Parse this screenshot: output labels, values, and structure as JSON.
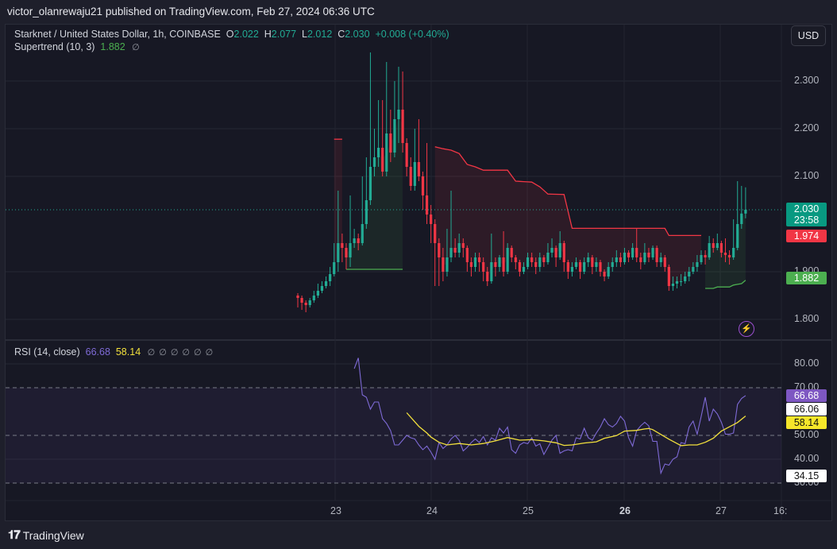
{
  "publisher": "victor_olanrewaju21 published on TradingView.com, Feb 27, 2024 06:36 UTC",
  "header": {
    "symbol": "Starknet / United States Dollar, 1h, COINBASE",
    "o_label": "O",
    "o": "2.022",
    "h_label": "H",
    "h": "2.077",
    "l_label": "L",
    "l": "2.012",
    "c_label": "C",
    "c": "2.030",
    "change": "+0.008 (+0.40%)",
    "supertrend_label": "Supertrend (10, 3)",
    "supertrend_value": "1.882",
    "rsi_label": "RSI (14, close)",
    "rsi_value": "66.68",
    "rsi_ma_value": "58.14",
    "empty_symbol": "∅"
  },
  "currency_button": "USD",
  "footer": {
    "logo": "TV",
    "brand": "TradingView"
  },
  "colors": {
    "up": "#22ab94",
    "down": "#f23645",
    "supertrend_up": "#4caf50",
    "supertrend_down": "#f23645",
    "rsi": "#7e6ad6",
    "rsi_ma": "#f2e03c",
    "background": "#171824"
  },
  "badges": {
    "last_price": "2.030",
    "countdown": "23:58",
    "supertrend_down": "1.974",
    "supertrend_up": "1.882",
    "rsi": "66.68",
    "rsi_a": "66.06",
    "rsi_ma": "58.14",
    "rsi_b": "34.15"
  },
  "chart_data": [
    {
      "type": "candlestick",
      "interval": "1h",
      "price_ticks": [
        "2.300",
        "2.200",
        "2.100",
        "1.900",
        "1.800"
      ],
      "ylim": [
        1.8,
        2.3
      ],
      "x_ticks": [
        "23",
        "24",
        "25",
        "26",
        "27",
        "16:"
      ],
      "grid": true,
      "close": [
        1.845,
        1.835,
        1.83,
        1.84,
        1.85,
        1.86,
        1.87,
        1.88,
        1.895,
        1.92,
        1.96,
        1.95,
        1.93,
        1.96,
        1.97,
        1.96,
        2.0,
        2.05,
        2.12,
        2.14,
        2.16,
        2.11,
        2.19,
        2.15,
        2.22,
        2.24,
        2.17,
        2.12,
        2.08,
        2.13,
        2.1,
        2.06,
        2.02,
        2.0,
        1.96,
        1.93,
        1.9,
        1.93,
        1.95,
        1.94,
        1.96,
        1.95,
        1.92,
        1.91,
        1.93,
        1.92,
        1.9,
        1.88,
        1.92,
        1.91,
        1.93,
        1.9,
        1.95,
        1.93,
        1.92,
        1.9,
        1.91,
        1.93,
        1.92,
        1.91,
        1.93,
        1.92,
        1.94,
        1.95,
        1.93,
        1.96,
        1.92,
        1.9,
        1.91,
        1.92,
        1.9,
        1.92,
        1.93,
        1.91,
        1.92,
        1.9,
        1.89,
        1.91,
        1.92,
        1.93,
        1.92,
        1.94,
        1.93,
        1.95,
        1.93,
        1.92,
        1.94,
        1.93,
        1.95,
        1.92,
        1.93,
        1.91,
        1.87,
        1.875,
        1.88,
        1.88,
        1.89,
        1.9,
        1.91,
        1.92,
        1.935,
        1.93,
        1.96,
        1.95,
        1.96,
        1.94,
        1.935,
        1.93,
        1.95,
        2.0,
        2.022,
        2.03
      ],
      "high": [
        1.855,
        1.85,
        1.84,
        1.845,
        1.86,
        1.875,
        1.88,
        1.89,
        1.91,
        1.96,
        2.07,
        1.98,
        1.96,
        2.06,
        1.99,
        1.98,
        2.1,
        2.14,
        2.36,
        2.2,
        2.26,
        2.26,
        2.34,
        2.24,
        2.3,
        2.33,
        2.32,
        2.18,
        2.14,
        2.2,
        2.22,
        2.11,
        2.17,
        2.04,
        2.01,
        1.97,
        1.95,
        1.99,
        2.07,
        1.97,
        1.98,
        1.97,
        1.955,
        1.93,
        1.94,
        1.94,
        1.93,
        1.91,
        1.98,
        1.93,
        1.935,
        1.985,
        1.96,
        1.955,
        1.935,
        1.925,
        1.92,
        1.94,
        1.94,
        1.93,
        1.94,
        1.935,
        1.96,
        1.97,
        1.955,
        1.985,
        1.965,
        1.925,
        1.92,
        1.93,
        1.925,
        1.93,
        1.94,
        1.935,
        1.93,
        1.925,
        1.905,
        1.92,
        1.93,
        1.945,
        1.94,
        1.95,
        1.945,
        1.96,
        1.99,
        1.94,
        1.96,
        1.95,
        1.955,
        1.955,
        1.94,
        1.935,
        1.915,
        1.89,
        1.89,
        1.895,
        1.9,
        1.91,
        1.92,
        1.935,
        1.945,
        1.945,
        1.975,
        1.97,
        1.98,
        1.965,
        1.97,
        1.945,
        2.01,
        2.09,
        2.08,
        2.077
      ],
      "low": [
        1.825,
        1.82,
        1.815,
        1.825,
        1.835,
        1.845,
        1.855,
        1.865,
        1.87,
        1.89,
        1.9,
        1.92,
        1.905,
        1.91,
        1.95,
        1.945,
        1.955,
        1.99,
        2.04,
        2.1,
        2.12,
        2.1,
        2.1,
        2.13,
        2.14,
        2.17,
        2.15,
        2.1,
        2.07,
        2.07,
        2.09,
        2.03,
        2.0,
        1.96,
        1.87,
        1.87,
        1.88,
        1.89,
        1.92,
        1.93,
        1.93,
        1.93,
        1.9,
        1.89,
        1.9,
        1.9,
        1.88,
        1.87,
        1.875,
        1.89,
        1.9,
        1.89,
        1.895,
        1.92,
        1.905,
        1.89,
        1.895,
        1.905,
        1.91,
        1.895,
        1.9,
        1.91,
        1.915,
        1.93,
        1.91,
        1.925,
        1.9,
        1.885,
        1.89,
        1.905,
        1.885,
        1.895,
        1.91,
        1.895,
        1.9,
        1.89,
        1.88,
        1.885,
        1.9,
        1.91,
        1.91,
        1.915,
        1.92,
        1.925,
        1.92,
        1.905,
        1.915,
        1.92,
        1.925,
        1.91,
        1.91,
        1.9,
        1.86,
        1.86,
        1.865,
        1.87,
        1.875,
        1.88,
        1.895,
        1.9,
        1.915,
        1.915,
        1.925,
        1.94,
        1.945,
        1.93,
        1.92,
        1.915,
        1.925,
        1.945,
        1.99,
        2.012
      ],
      "supertrend": [
        {
          "direction": "down",
          "points": [
            [
              9,
              2.178
            ],
            [
              11,
              2.178
            ]
          ]
        },
        {
          "direction": "up",
          "points": [
            [
              12,
              1.905
            ],
            [
              26,
              1.905
            ]
          ]
        },
        {
          "direction": "down",
          "points": [
            [
              34,
              2.162
            ],
            [
              36,
              2.158
            ],
            [
              38,
              2.155
            ],
            [
              40,
              2.148
            ],
            [
              42,
              2.125
            ],
            [
              44,
              2.12
            ],
            [
              46,
              2.113
            ],
            [
              52,
              2.113
            ],
            [
              54,
              2.09
            ],
            [
              58,
              2.088
            ],
            [
              60,
              2.078
            ],
            [
              62,
              2.063
            ],
            [
              66,
              2.062
            ],
            [
              68,
              1.991
            ],
            [
              91,
              1.991
            ],
            [
              92,
              1.976
            ],
            [
              100,
              1.976
            ]
          ]
        },
        {
          "direction": "up",
          "points": [
            [
              101,
              1.865
            ],
            [
              103,
              1.865
            ],
            [
              104,
              1.868
            ],
            [
              107,
              1.868
            ],
            [
              108,
              1.872
            ],
            [
              110,
              1.875
            ],
            [
              111,
              1.882
            ]
          ]
        }
      ]
    },
    {
      "type": "line",
      "name": "RSI (14, close)",
      "y_ticks": [
        "80.00",
        "70.00",
        "50.00",
        "40.00",
        "30.00"
      ],
      "ylim": [
        26,
        90
      ],
      "bands": [
        70,
        50,
        30
      ],
      "rsi_start_index": 14,
      "rsi": [
        78,
        82.5,
        67,
        66,
        61,
        64,
        64,
        57,
        55,
        52,
        46,
        46,
        48,
        50,
        49,
        48.5,
        46,
        44,
        45.5,
        43,
        40,
        47,
        44.5,
        46,
        48.5,
        50,
        48,
        43.5,
        45,
        47,
        48.5,
        47,
        49.5,
        46,
        49,
        48,
        53,
        51,
        53.5,
        44,
        42.5,
        46,
        47,
        46.5,
        49,
        45.5,
        46.5,
        42,
        45,
        48,
        50,
        42.5,
        43.5,
        44,
        43.5,
        49,
        48.5,
        53,
        49,
        48,
        51,
        53.5,
        57,
        54.5,
        53.5,
        55,
        58,
        56,
        49,
        45.5,
        52,
        54,
        55.5,
        54,
        47.5,
        47.5,
        34.15,
        38,
        37.5,
        40,
        41,
        47,
        46.5,
        53.5,
        56,
        50.5,
        58,
        66,
        56,
        61,
        59,
        55.5,
        50.5,
        50.5,
        51,
        63,
        65.5,
        66.68
      ],
      "rsi_ma": [
        [
          27,
          59.5
        ],
        [
          30,
          53.8
        ],
        [
          32,
          51
        ],
        [
          33,
          49.3
        ],
        [
          35,
          47.1
        ],
        [
          37,
          46
        ],
        [
          40,
          46.6
        ],
        [
          43,
          46
        ],
        [
          46,
          46.6
        ],
        [
          49,
          47.7
        ],
        [
          52,
          49.1
        ],
        [
          55,
          48
        ],
        [
          58,
          48.2
        ],
        [
          61,
          47.7
        ],
        [
          64,
          46.9
        ],
        [
          66,
          45.8
        ],
        [
          68,
          46
        ],
        [
          71,
          46.8
        ],
        [
          74,
          47.3
        ],
        [
          76,
          48.8
        ],
        [
          79,
          49.9
        ],
        [
          81,
          51.8
        ],
        [
          84,
          52.1
        ],
        [
          86,
          52.7
        ],
        [
          87,
          52.9
        ],
        [
          88,
          52.4
        ],
        [
          90,
          50.4
        ],
        [
          92,
          48.4
        ],
        [
          94,
          46.6
        ],
        [
          95,
          45.7
        ],
        [
          97,
          46
        ],
        [
          99,
          46
        ],
        [
          101,
          47.1
        ],
        [
          103,
          48.8
        ],
        [
          105,
          51.8
        ],
        [
          107,
          53.6
        ],
        [
          109,
          55.4
        ],
        [
          111,
          58.14
        ]
      ]
    }
  ]
}
